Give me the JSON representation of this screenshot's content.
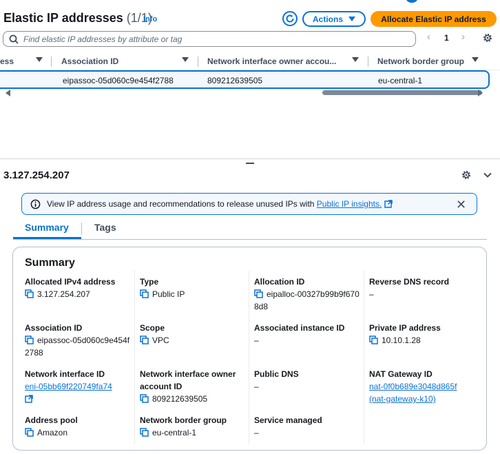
{
  "header": {
    "title": "Elastic IP addresses",
    "count": "(1/1)",
    "info": "Info",
    "actions_label": "Actions",
    "allocate_label": "Allocate Elastic IP address",
    "accent_color": "#0972d3",
    "primary_color": "#ff9900"
  },
  "search": {
    "placeholder": "Find elastic IP addresses by attribute or tag",
    "page": "1"
  },
  "table": {
    "columns": [
      "ess",
      "Association ID",
      "Network interface owner accou...",
      "Network border group"
    ],
    "rows": [
      {
        "association_id": "eipassoc-05d060c9e454f2788",
        "owner": "809212639505",
        "border_group": "eu-central-1"
      }
    ]
  },
  "detail": {
    "title": "3.127.254.207",
    "flash": {
      "text": "View IP address usage and recommendations to release unused IPs with",
      "link": "Public IP insights."
    },
    "tabs": [
      "Summary",
      "Tags"
    ],
    "summary_title": "Summary",
    "fields": {
      "allocated_ipv4": {
        "label": "Allocated IPv4 address",
        "value": "3.127.254.207"
      },
      "type": {
        "label": "Type",
        "value": "Public IP"
      },
      "allocation_id": {
        "label": "Allocation ID",
        "value": "eipalloc-00327b99b9f6708d8"
      },
      "reverse_dns": {
        "label": "Reverse DNS record",
        "value": "–"
      },
      "association_id": {
        "label": "Association ID",
        "value": "eipassoc-05d060c9e454f2788"
      },
      "scope": {
        "label": "Scope",
        "value": "VPC"
      },
      "associated_instance": {
        "label": "Associated instance ID",
        "value": "–"
      },
      "private_ip": {
        "label": "Private IP address",
        "value": "10.10.1.28"
      },
      "eni": {
        "label": "Network interface ID",
        "value": "eni-05bb69f220749fa74"
      },
      "eni_owner": {
        "label": "Network interface owner account ID",
        "value": "809212639505"
      },
      "public_dns": {
        "label": "Public DNS",
        "value": "–"
      },
      "nat_gateway": {
        "label": "NAT Gateway ID",
        "value": "nat-0f0b689e3048d865f (nat-gateway-k10)"
      },
      "address_pool": {
        "label": "Address pool",
        "value": "Amazon"
      },
      "border_group": {
        "label": "Network border group",
        "value": "eu-central-1"
      },
      "service_managed": {
        "label": "Service managed",
        "value": "–"
      }
    }
  }
}
